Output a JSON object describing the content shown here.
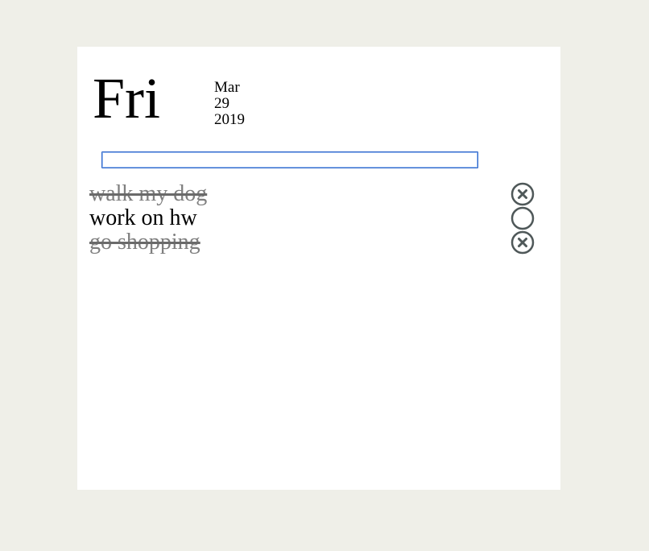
{
  "header": {
    "day": "Fri",
    "month": "Mar",
    "date": "29",
    "year": "2019"
  },
  "input": {
    "value": "",
    "placeholder": ""
  },
  "todos": [
    {
      "text": "walk my dog",
      "done": true,
      "icon": "x-circle-icon"
    },
    {
      "text": "work on hw",
      "done": false,
      "icon": "empty-circle-icon"
    },
    {
      "text": "go shopping",
      "done": true,
      "icon": "x-circle-icon"
    }
  ],
  "colors": {
    "background": "#efefe8",
    "card": "#ffffff",
    "done_text": "#7f7f7f",
    "icon": "#4f5859",
    "input_border": "#2a63c9"
  }
}
